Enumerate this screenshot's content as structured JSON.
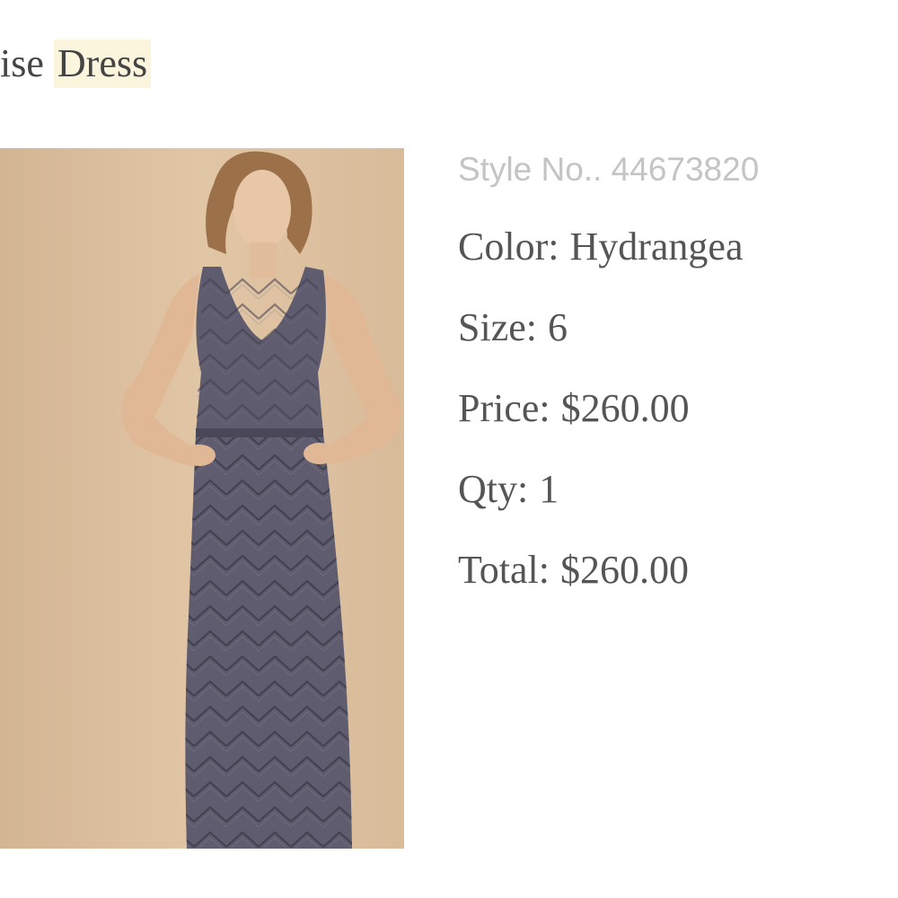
{
  "product": {
    "title_prefix": "ise",
    "title_highlight": "Dress",
    "image_alt": "Model wearing a sleeveless V-neck beaded maxi dress in slate gray"
  },
  "details": {
    "style_no": "Style No.. 44673820",
    "color_label": "Color:",
    "color_value": "Hydrangea",
    "size_label": "Size:",
    "size_value": "6",
    "price_label": "Price:",
    "price_value": "$260.00",
    "qty_label": "Qty:",
    "qty_value": "1",
    "total_label": "Total:",
    "total_value": "$260.00"
  },
  "colors": {
    "backdrop": "#dcc0a0",
    "dress": "#5e5c6e",
    "title_highlight": "#fbf5dd",
    "text": "#555555",
    "muted": "#c4c4c4"
  }
}
